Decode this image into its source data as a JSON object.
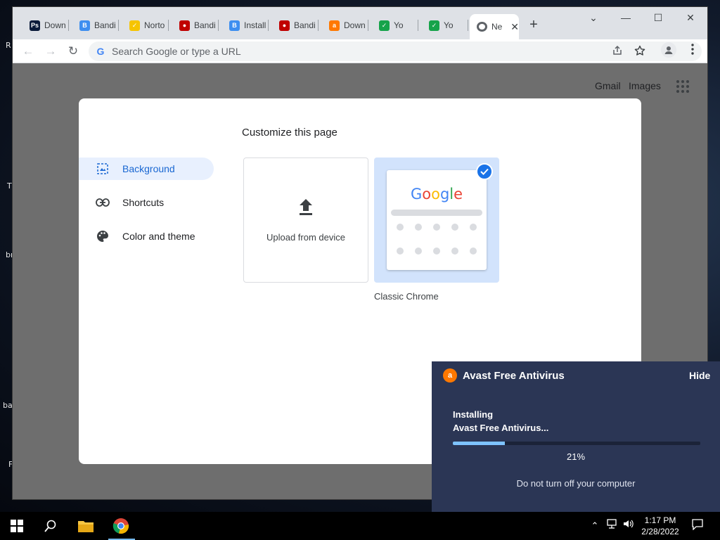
{
  "desktop": {
    "peek_labels": [
      "R",
      "T",
      "br",
      "ba",
      "F"
    ]
  },
  "browser": {
    "tabs": [
      {
        "label": "Down",
        "icon": "photoshop-icon",
        "color": "#0a1a3a",
        "glyph": "Ps"
      },
      {
        "label": "Bandi",
        "icon": "bandicam-icon",
        "color": "#3d8ef0",
        "glyph": "B"
      },
      {
        "label": "Norto",
        "icon": "norton-icon",
        "color": "#f6c400",
        "glyph": "✓"
      },
      {
        "label": "Bandi",
        "icon": "record-icon",
        "color": "#c00000",
        "glyph": "●"
      },
      {
        "label": "Install",
        "icon": "bandicam-icon",
        "color": "#3d8ef0",
        "glyph": "B"
      },
      {
        "label": "Bandi",
        "icon": "record-icon",
        "color": "#c00000",
        "glyph": "●"
      },
      {
        "label": "Down",
        "icon": "avast-icon",
        "color": "#ff7800",
        "glyph": "a"
      },
      {
        "label": "Yo",
        "icon": "checkbox-icon",
        "color": "#16a34a",
        "glyph": "✓"
      },
      {
        "label": "Yo",
        "icon": "checkbox-icon",
        "color": "#16a34a",
        "glyph": "✓"
      }
    ],
    "active_tab": {
      "label": "Ne",
      "icon": "chrome-icon"
    },
    "new_tab_symbol": "+",
    "close_symbol": "✕",
    "window_controls": {
      "chevron": "⌄",
      "minimize": "—",
      "maximize": "☐",
      "close": "✕"
    },
    "omnibox": {
      "placeholder": "Search Google or type a URL",
      "g_icon": "G"
    },
    "nav": {
      "back": "←",
      "forward": "→",
      "reload": "↻"
    },
    "top_links": {
      "gmail": "Gmail",
      "images": "Images"
    }
  },
  "customize": {
    "title": "Customize this page",
    "sidebar": [
      {
        "label": "Background",
        "icon": "background-image-icon",
        "active": true
      },
      {
        "label": "Shortcuts",
        "icon": "link-icon",
        "active": false
      },
      {
        "label": "Color and theme",
        "icon": "palette-icon",
        "active": false
      }
    ],
    "upload_label": "Upload from device",
    "classic_label": "Classic Chrome",
    "classic_logo": "Google"
  },
  "avast": {
    "title": "Avast Free Antivirus",
    "hide": "Hide",
    "status_line1": "Installing",
    "status_line2": "Avast Free Antivirus...",
    "progress_fraction": 0.21,
    "progress_text": "21%",
    "warning": "Do not turn off your computer",
    "accent": "#7ec3ff"
  },
  "taskbar": {
    "time": "1:17 PM",
    "date": "2/28/2022"
  }
}
